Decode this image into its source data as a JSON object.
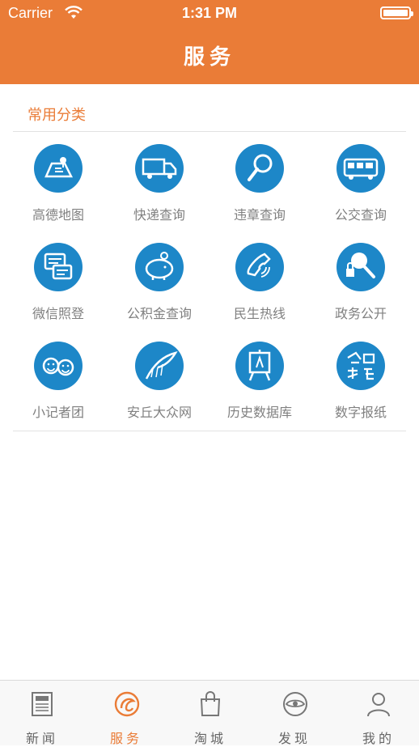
{
  "status_bar": {
    "carrier": "Carrier",
    "time": "1:31 PM"
  },
  "header": {
    "title": "服务"
  },
  "section": {
    "title": "常用分类"
  },
  "services": [
    {
      "label": "高德地图",
      "icon": "map-icon"
    },
    {
      "label": "快递查询",
      "icon": "delivery-truck-icon"
    },
    {
      "label": "违章查询",
      "icon": "magnifier-icon"
    },
    {
      "label": "公交查询",
      "icon": "bus-icon"
    },
    {
      "label": "微信照登",
      "icon": "chat-bubbles-icon"
    },
    {
      "label": "公积金查询",
      "icon": "piggy-bank-icon"
    },
    {
      "label": "民生热线",
      "icon": "phone-icon"
    },
    {
      "label": "政务公开",
      "icon": "search-lock-icon"
    },
    {
      "label": "小记者团",
      "icon": "kids-faces-icon"
    },
    {
      "label": "安丘大众网",
      "icon": "feather-logo-icon"
    },
    {
      "label": "历史数据库",
      "icon": "easel-icon"
    },
    {
      "label": "数字报纸",
      "icon": "calligraphy-icon"
    }
  ],
  "tabs": [
    {
      "label": "新闻",
      "icon": "newspaper-icon",
      "active": false
    },
    {
      "label": "服务",
      "icon": "service-icon",
      "active": true
    },
    {
      "label": "淘城",
      "icon": "shopping-bag-icon",
      "active": false
    },
    {
      "label": "发现",
      "icon": "eye-icon",
      "active": false
    },
    {
      "label": "我的",
      "icon": "user-icon",
      "active": false
    }
  ],
  "colors": {
    "accent": "#ea7c37",
    "icon_bg": "#1d87c8",
    "label": "#808080"
  }
}
